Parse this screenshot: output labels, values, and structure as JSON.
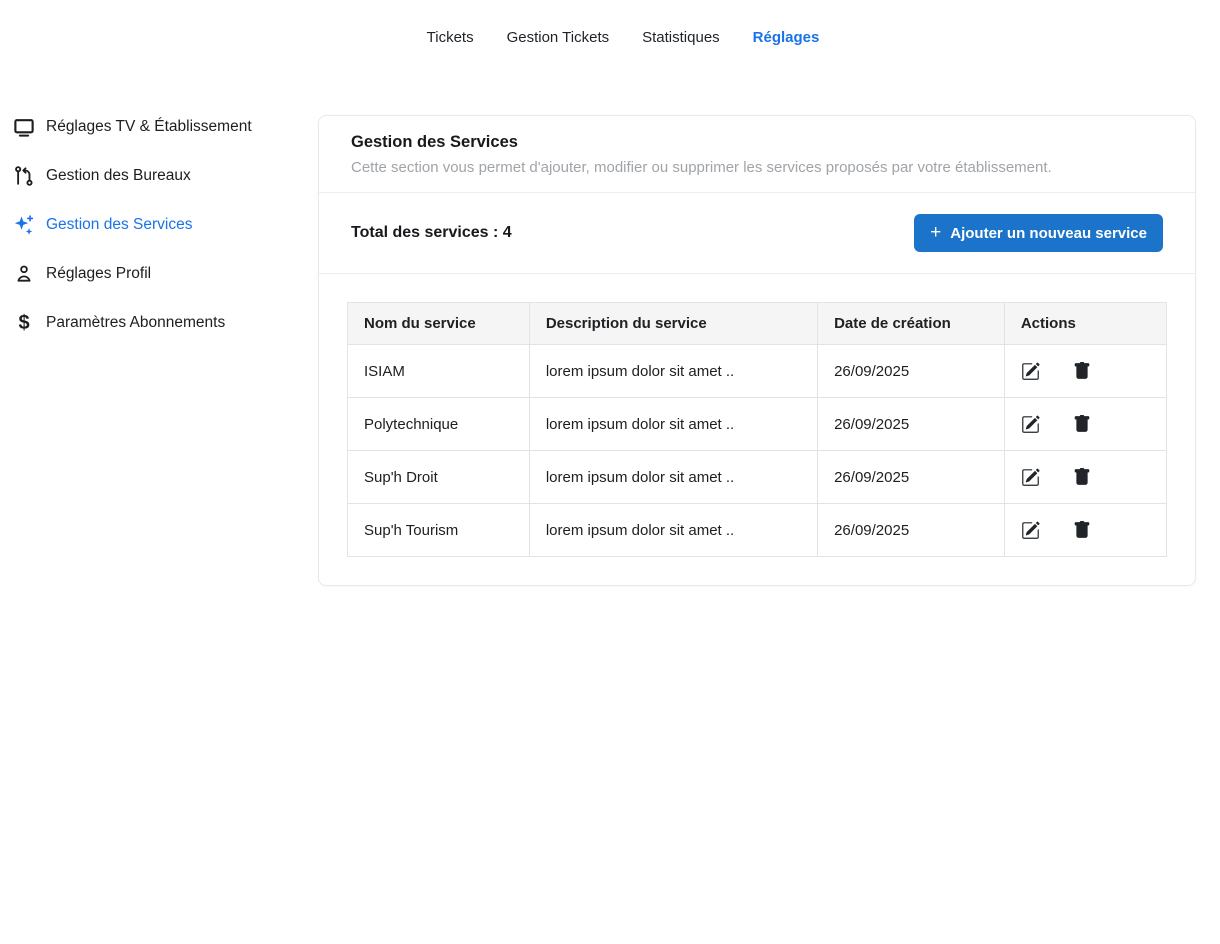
{
  "colors": {
    "accent": "#1a73e8",
    "button_bg": "#1b74c9",
    "table_header_bg": "#f5f5f5"
  },
  "nav": {
    "items": [
      {
        "label": "Tickets",
        "active": false
      },
      {
        "label": "Gestion Tickets",
        "active": false
      },
      {
        "label": "Statistiques",
        "active": false
      },
      {
        "label": "Réglages",
        "active": true
      }
    ]
  },
  "sidebar": {
    "items": [
      {
        "label": "Réglages TV & Établissement",
        "icon": "tv-icon",
        "active": false
      },
      {
        "label": "Gestion des Bureaux",
        "icon": "route-icon",
        "active": false
      },
      {
        "label": "Gestion des Services",
        "icon": "sparkles-icon",
        "active": true
      },
      {
        "label": "Réglages Profil",
        "icon": "user-icon",
        "active": false
      },
      {
        "label": "Paramètres Abonnements",
        "icon": "dollar-icon",
        "active": false
      }
    ]
  },
  "panel": {
    "title": "Gestion des Services",
    "description": "Cette section vous permet d'ajouter, modifier ou supprimer les services proposés par votre établissement.",
    "total": "Total des services : 4",
    "add_button_label": "Ajouter un nouveau service",
    "plus_glyph": "+",
    "dollar_glyph": "$"
  },
  "table": {
    "columns": [
      "Nom du service",
      "Description du service",
      "Date de création",
      "Actions"
    ],
    "rows": [
      {
        "name": "ISIAM",
        "description": "lorem ipsum dolor sit amet ..",
        "date": "26/09/2025"
      },
      {
        "name": "Polytechnique",
        "description": "lorem ipsum dolor sit amet ..",
        "date": "26/09/2025"
      },
      {
        "name": "Sup'h Droit",
        "description": "lorem ipsum dolor sit amet ..",
        "date": "26/09/2025"
      },
      {
        "name": "Sup'h Tourism",
        "description": "lorem ipsum dolor sit amet ..",
        "date": "26/09/2025"
      }
    ]
  }
}
